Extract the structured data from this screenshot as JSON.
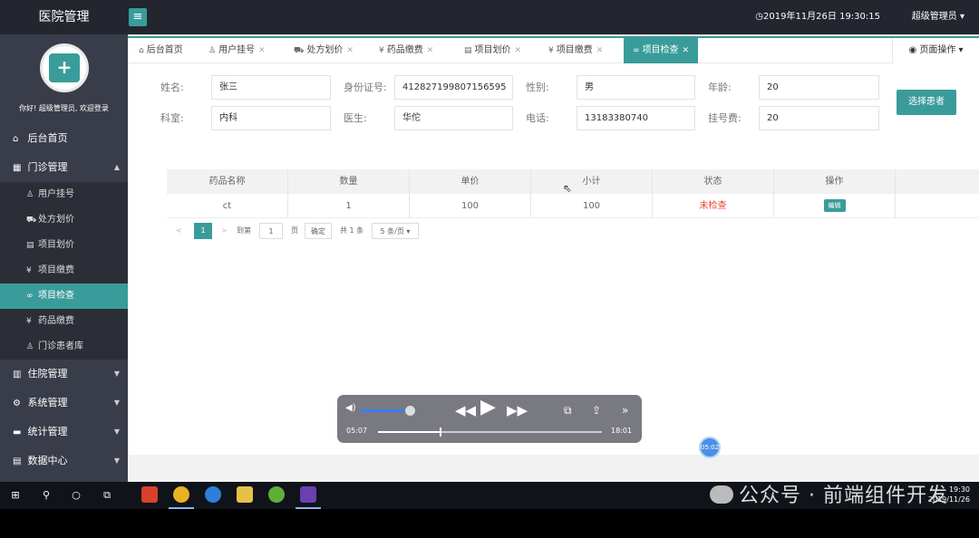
{
  "header": {
    "app_title": "医院管理",
    "menu_toggle_icon": "≡",
    "datetime": "◷2019年11月26日 19:30:15",
    "user_label": "超级管理员 ▾"
  },
  "sidebar": {
    "welcome": "你好! 超级管理员, 欢迎登录",
    "items": [
      {
        "label": "后台首页",
        "icon": "home-icon"
      },
      {
        "label": "门诊管理",
        "icon": "grid-icon"
      },
      {
        "label": "住院管理",
        "icon": "book-icon"
      },
      {
        "label": "系统管理",
        "icon": "gear-icon"
      },
      {
        "label": "统计管理",
        "icon": "chat-icon"
      },
      {
        "label": "数据中心",
        "icon": "doc-icon"
      }
    ],
    "sub_items": [
      {
        "label": "用户挂号",
        "icon": "user-icon"
      },
      {
        "label": "处方划价",
        "icon": "cart-icon"
      },
      {
        "label": "项目划价",
        "icon": "doc-icon"
      },
      {
        "label": "项目缴费",
        "icon": "yen-icon"
      },
      {
        "label": "项目检查",
        "icon": "link-icon"
      },
      {
        "label": "药品缴费",
        "icon": "yen-icon"
      },
      {
        "label": "门诊患者库",
        "icon": "person-icon"
      }
    ]
  },
  "tabs": [
    {
      "label": "后台首页",
      "icon": "⌂"
    },
    {
      "label": "用户挂号",
      "icon": "♙"
    },
    {
      "label": "处方划价",
      "icon": "⛟"
    },
    {
      "label": "药品缴费",
      "icon": "¥"
    },
    {
      "label": "项目划价",
      "icon": "▤"
    },
    {
      "label": "项目缴费",
      "icon": "¥"
    },
    {
      "label": "项目检查",
      "icon": "∞"
    }
  ],
  "page_ops": "◉ 页面操作 ▾",
  "form": {
    "name_label": "姓名:",
    "name": "张三",
    "id_label": "身份证号:",
    "id_number": "412827199807156595",
    "gender_label": "性别:",
    "gender": "男",
    "age_label": "年龄:",
    "age": "20",
    "dept_label": "科室:",
    "dept": "内科",
    "doctor_label": "医生:",
    "doctor": "华佗",
    "phone_label": "电话:",
    "phone": "13183380740",
    "fee_label": "挂号费:",
    "fee": "20",
    "pick_button": "选择患者"
  },
  "table": {
    "headers": [
      "药品名称",
      "数量",
      "单价",
      "小计",
      "状态",
      "操作"
    ],
    "rows": [
      {
        "name": "ct",
        "qty": "1",
        "price": "100",
        "subtotal": "100",
        "status": "未检查",
        "action": "编辑"
      }
    ]
  },
  "pager": {
    "prev": "<",
    "current": "1",
    "next": ">",
    "goto_label": "到第",
    "goto_value": "1",
    "page_unit": "页",
    "confirm": "确定",
    "total": "共 1 条",
    "page_size": "5 条/页 ▾"
  },
  "player": {
    "elapsed": "05:07",
    "duration": "18:01",
    "progress_fraction": 0.28,
    "volume_fraction": 0.93,
    "bubble_time": "05:02"
  },
  "taskbar": {
    "tray_time": "19:30",
    "tray_date": "2019/11/26"
  },
  "watermark": "公众号 · 前端组件开发",
  "colors": {
    "accent": "#3a9c9a",
    "header_bg": "#23262e",
    "sidebar_bg": "#393d49",
    "status_unchecked": "#e8452e"
  }
}
